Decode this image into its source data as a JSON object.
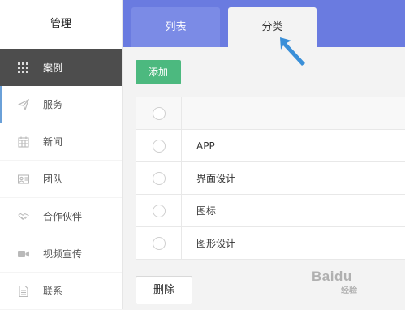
{
  "sidebar": {
    "title": "管理",
    "items": [
      {
        "label": "案例",
        "icon": "grid-icon",
        "active": true
      },
      {
        "label": "服务",
        "icon": "paper-plane-icon"
      },
      {
        "label": "新闻",
        "icon": "calendar-icon"
      },
      {
        "label": "团队",
        "icon": "id-card-icon"
      },
      {
        "label": "合作伙伴",
        "icon": "handshake-icon"
      },
      {
        "label": "视频宣传",
        "icon": "video-camera-icon"
      },
      {
        "label": "联系",
        "icon": "document-icon"
      }
    ]
  },
  "tabs": {
    "list": "列表",
    "category": "分类",
    "active": "category"
  },
  "toolbar": {
    "add_label": "添加"
  },
  "table": {
    "rows": [
      "APP",
      "界面设计",
      "图标",
      "图形设计"
    ]
  },
  "footer": {
    "delete_label": "删除"
  },
  "watermark": {
    "text": "Baidu",
    "sub": "经验"
  },
  "colors": {
    "header": "#6a7be0",
    "sidebar_active": "#4d4d4d",
    "add_button": "#4cb97f",
    "arrow": "#3a8fd8"
  }
}
